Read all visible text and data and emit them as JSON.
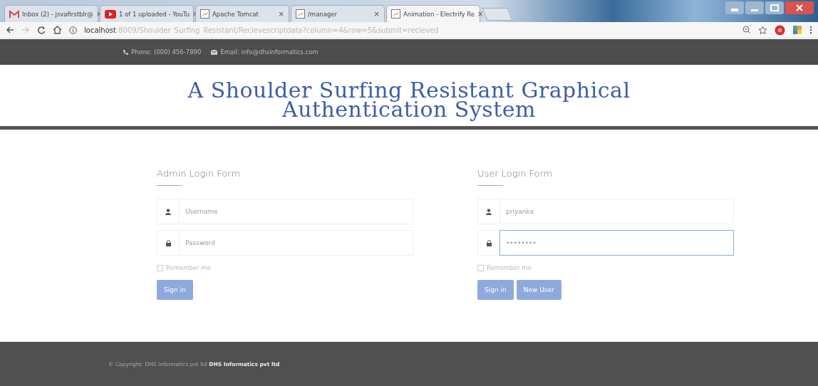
{
  "browser": {
    "tabs": [
      {
        "title": "Inbox (2) - jsvafirstblr@",
        "kind": "mail",
        "close": "×",
        "selected": false
      },
      {
        "title": "1 of 1 uploaded - YouTu",
        "kind": "video",
        "close": "×",
        "selected": false
      },
      {
        "title": "Apache Tomcat",
        "kind": "page",
        "close": "×",
        "selected": false
      },
      {
        "title": "/manager",
        "kind": "page",
        "close": "×",
        "selected": false
      },
      {
        "title": "Animation - Electrify Re",
        "kind": "page",
        "close": "×",
        "selected": true
      }
    ],
    "address": {
      "host": "localhost",
      "path": ":8009/Shoulder_Surfing_Resistant/Recievescriptdata?column=4&row=5&submit=recieved"
    }
  },
  "topbar": {
    "phone": "Phone: (000) 456-7890",
    "email": "Email: info@dhsinformatics.com"
  },
  "title": "A Shoulder Surfing Resistant Graphical Authentication System",
  "forms": [
    {
      "title": "Admin Login Form",
      "fields": [
        {
          "kind": "user",
          "placeholder": "Username",
          "focused": false
        },
        {
          "kind": "lock",
          "placeholder": "Password",
          "focused": false
        }
      ],
      "remember": {
        "label": "Remember me",
        "checked": false
      },
      "buttons": [
        "Sign in"
      ]
    },
    {
      "title": "User Login Form",
      "fields": [
        {
          "kind": "user",
          "value": "priyanka",
          "focused": false
        },
        {
          "kind": "lock",
          "value": "••••••••",
          "focused": true
        }
      ],
      "remember": {
        "label": "Remember me",
        "checked": false
      },
      "buttons": [
        "Sign in",
        "New User"
      ]
    }
  ],
  "footer": {
    "text": "© Copyright: DHS Informatics pvt ltd **DHS Informatics pvt ltd**"
  }
}
